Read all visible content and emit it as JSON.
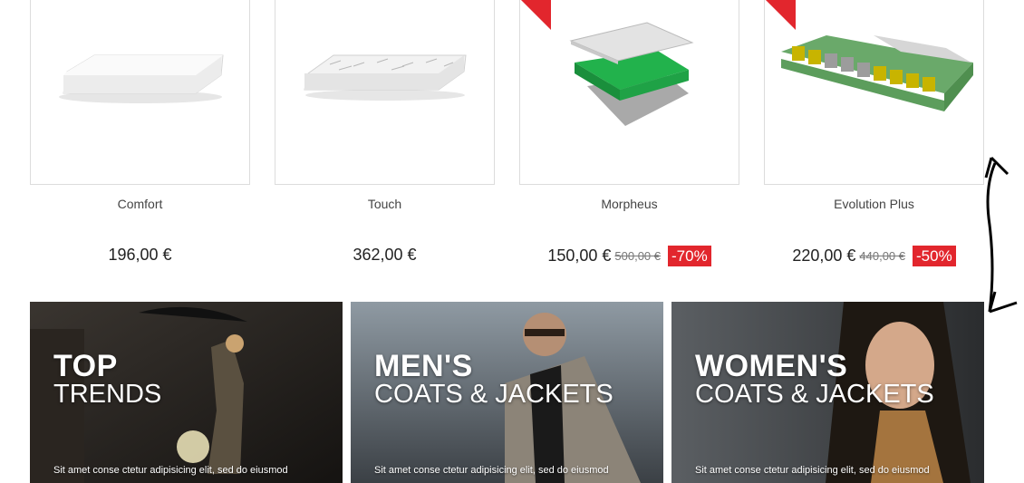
{
  "products": [
    {
      "name": "Comfort",
      "price": "196,00 €",
      "old_price": "",
      "discount": ""
    },
    {
      "name": "Touch",
      "price": "362,00 €",
      "old_price": "",
      "discount": ""
    },
    {
      "name": "Morpheus",
      "price": "150,00 €",
      "old_price": "500,00 €",
      "discount": "-70%"
    },
    {
      "name": "Evolution Plus",
      "price": "220,00 €",
      "old_price": "440,00 €",
      "discount": "-50%"
    }
  ],
  "banners": [
    {
      "title": "TOP",
      "subtitle": "TRENDS",
      "text": "Sit amet conse ctetur adipisicing elit, sed do eiusmod"
    },
    {
      "title": "MEN'S",
      "subtitle": "COATS & JACKETS",
      "text": "Sit amet conse ctetur adipisicing elit, sed do eiusmod"
    },
    {
      "title": "WOMEN'S",
      "subtitle": "COATS & JACKETS",
      "text": "Sit amet conse ctetur adipisicing elit, sed do eiusmod"
    }
  ],
  "colors": {
    "sale_badge": "#e2262d",
    "border": "#dcdcdc"
  },
  "icons": {
    "annotation": "double-headed-arrow-icon"
  }
}
